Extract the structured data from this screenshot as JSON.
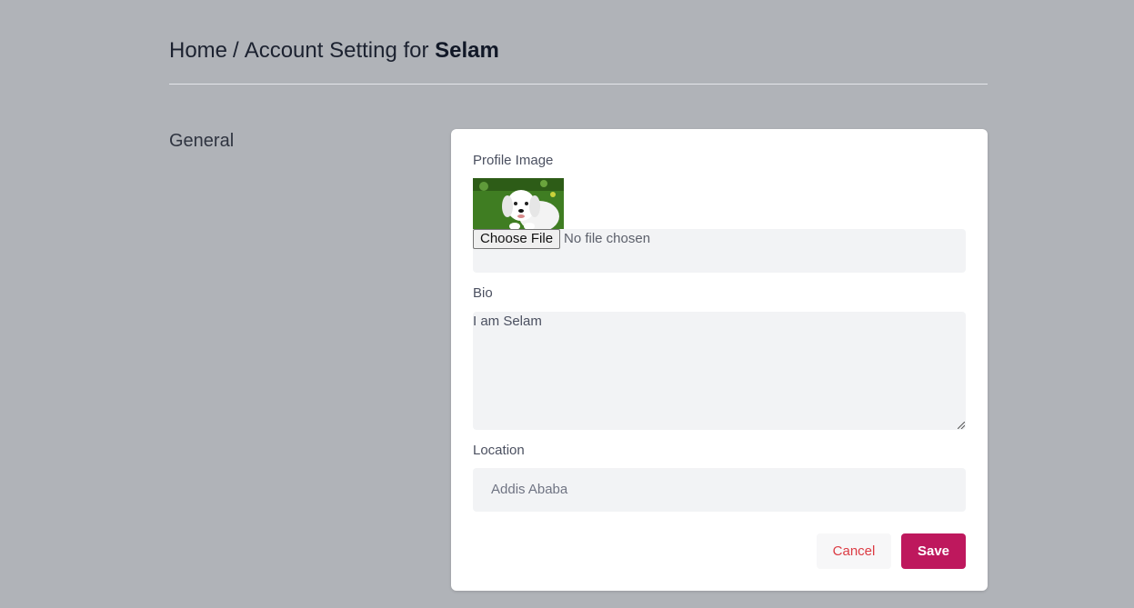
{
  "breadcrumb": {
    "home": "Home",
    "separator": "/",
    "prefix": "Account Setting for",
    "user": "Selam"
  },
  "section": {
    "title": "General"
  },
  "form": {
    "profile_image_label": "Profile Image",
    "file_button_label": "Choose File",
    "file_status": "No file chosen",
    "bio_label": "Bio",
    "bio_value": "I am Selam",
    "location_label": "Location",
    "location_value": "Addis Ababa"
  },
  "actions": {
    "cancel_label": "Cancel",
    "save_label": "Save"
  },
  "colors": {
    "background": "#b0b3b8",
    "card": "#ffffff",
    "field": "#f2f3f5",
    "save": "#be185d",
    "cancel_text": "#dc3b43"
  }
}
